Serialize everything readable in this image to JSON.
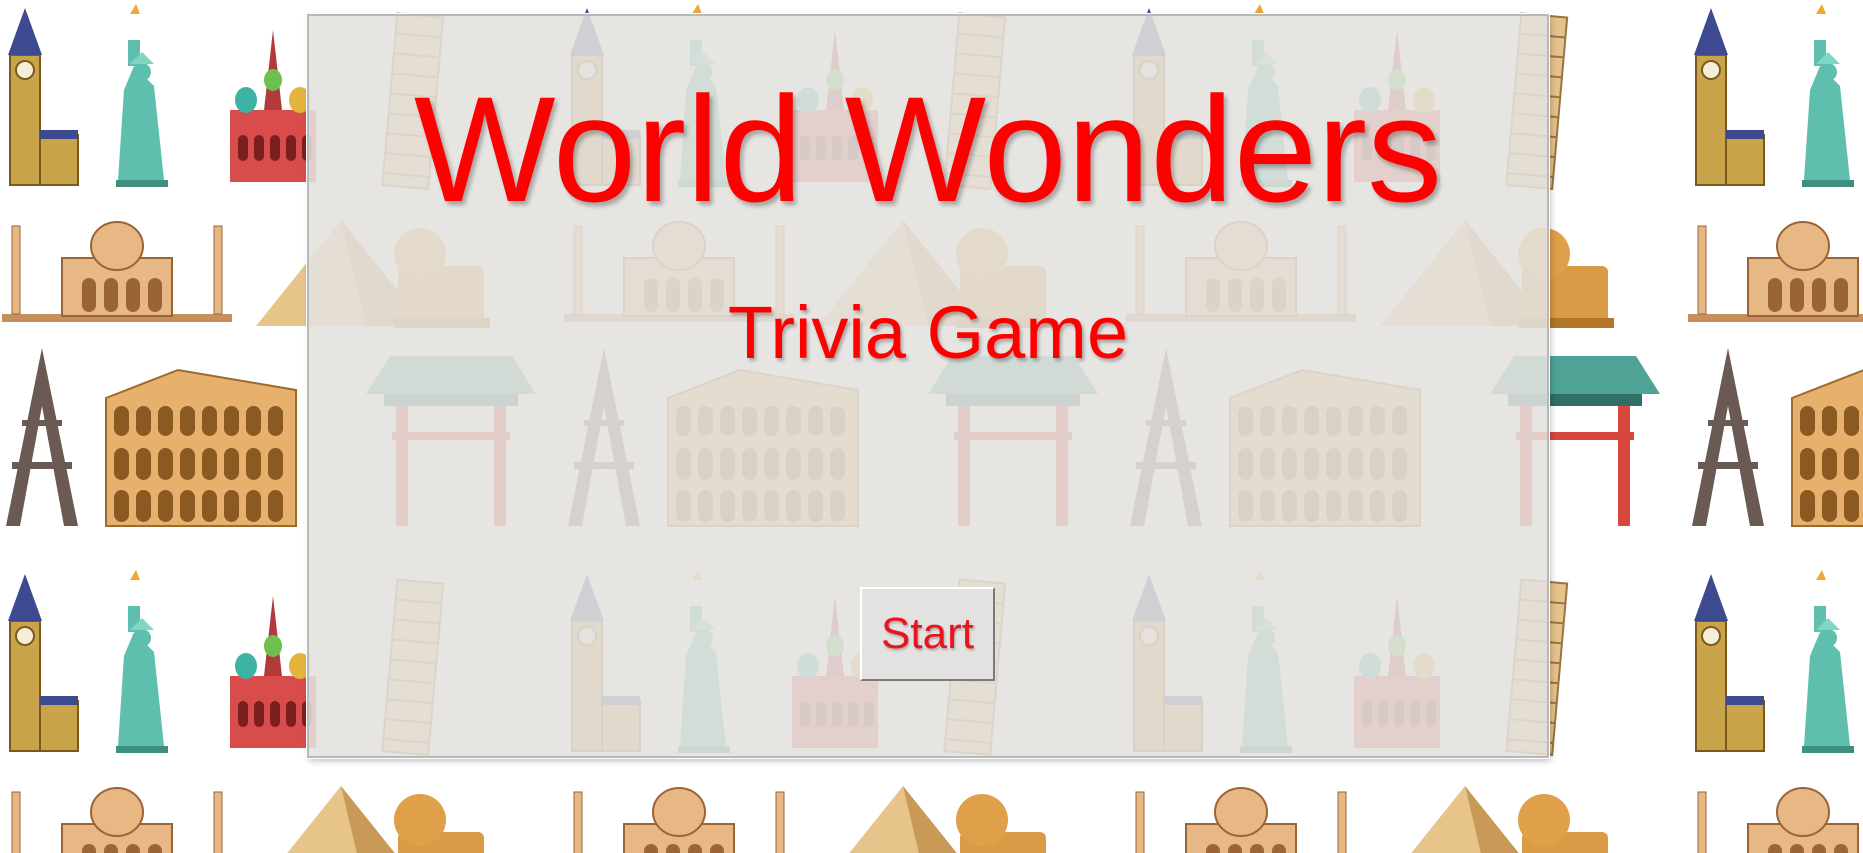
{
  "game": {
    "title": "World Wonders",
    "subtitle": "Trivia Game",
    "start_label": "Start"
  },
  "colors": {
    "title": "#ff0000",
    "panel": "#e4e1de",
    "button_text": "#e8141e"
  },
  "background_icons": [
    "big-ben-icon",
    "statue-of-liberty-icon",
    "st-basils-cathedral-icon",
    "leaning-tower-icon",
    "taj-mahal-icon",
    "pyramid-icon",
    "sphinx-icon",
    "eiffel-tower-icon",
    "colosseum-icon",
    "pagoda-gate-icon"
  ]
}
